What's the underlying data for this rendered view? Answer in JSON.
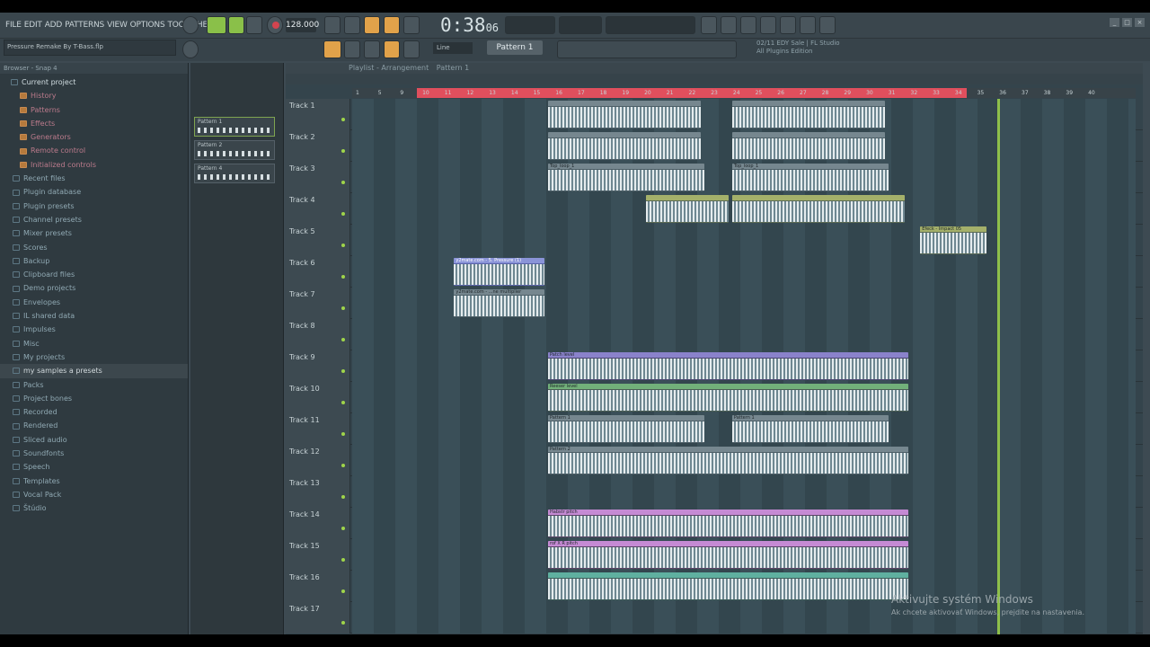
{
  "menu": [
    "FILE",
    "EDIT",
    "ADD",
    "PATTERNS",
    "VIEW",
    "OPTIONS",
    "TOOLS",
    "HELP"
  ],
  "transport": {
    "tempo": "128.000",
    "time": "0:38",
    "time_sub": "06"
  },
  "song": {
    "title": "Pressure Remake By T-Bass.flp"
  },
  "snap": {
    "value": "Line"
  },
  "pattern_selector": "Pattern 1",
  "news": {
    "line1": "02/11 EDY Sale | FL Studio",
    "line2": "All Plugins Edition"
  },
  "browser": {
    "title": "Browser - Snap 4",
    "items": [
      {
        "label": "Current project",
        "type": "head"
      },
      {
        "label": "History",
        "type": "sub"
      },
      {
        "label": "Patterns",
        "type": "sub"
      },
      {
        "label": "Effects",
        "type": "sub"
      },
      {
        "label": "Generators",
        "type": "sub"
      },
      {
        "label": "Remote control",
        "type": "sub"
      },
      {
        "label": "Initialized controls",
        "type": "sub"
      },
      {
        "label": "Recent files",
        "type": "folder"
      },
      {
        "label": "Plugin database",
        "type": "folder"
      },
      {
        "label": "Plugin presets",
        "type": "folder"
      },
      {
        "label": "Channel presets",
        "type": "folder"
      },
      {
        "label": "Mixer presets",
        "type": "folder"
      },
      {
        "label": "Scores",
        "type": "folder"
      },
      {
        "label": "Backup",
        "type": "folder"
      },
      {
        "label": "Clipboard files",
        "type": "folder"
      },
      {
        "label": "Demo projects",
        "type": "folder"
      },
      {
        "label": "Envelopes",
        "type": "folder"
      },
      {
        "label": "IL shared data",
        "type": "folder"
      },
      {
        "label": "Impulses",
        "type": "folder"
      },
      {
        "label": "Misc",
        "type": "folder"
      },
      {
        "label": "My projects",
        "type": "folder"
      },
      {
        "label": "my samples a presets",
        "type": "sel"
      },
      {
        "label": "Packs",
        "type": "folder"
      },
      {
        "label": "Project bones",
        "type": "folder"
      },
      {
        "label": "Recorded",
        "type": "folder"
      },
      {
        "label": "Rendered",
        "type": "folder"
      },
      {
        "label": "Sliced audio",
        "type": "folder"
      },
      {
        "label": "Soundfonts",
        "type": "folder"
      },
      {
        "label": "Speech",
        "type": "folder"
      },
      {
        "label": "Templates",
        "type": "folder"
      },
      {
        "label": "Vocal Pack",
        "type": "folder"
      },
      {
        "label": "Štúdio",
        "type": "folder"
      }
    ]
  },
  "picker": [
    {
      "label": "Pattern 1"
    },
    {
      "label": "Pattern 2"
    },
    {
      "label": "Pattern 4"
    }
  ],
  "playlist": {
    "title": "Playlist - Arrangement",
    "pattern": "Pattern 1",
    "ruler_numbers": [
      "1",
      "5",
      "9",
      "10",
      "11",
      "12",
      "13",
      "14",
      "15",
      "16",
      "17",
      "18",
      "19",
      "20",
      "21",
      "22",
      "23",
      "24",
      "25",
      "26",
      "27",
      "28",
      "29",
      "30",
      "31",
      "32",
      "33",
      "34",
      "35",
      "36",
      "37",
      "38",
      "39",
      "40"
    ],
    "tracks": [
      {
        "name": "Track 1",
        "clips": [
          {
            "start": 25.0,
            "len": 19.5,
            "color": "c-gray",
            "label": ""
          },
          {
            "start": 48.5,
            "len": 19.5,
            "color": "c-gray",
            "label": ""
          }
        ]
      },
      {
        "name": "Track 2",
        "clips": [
          {
            "start": 25.0,
            "len": 19.5,
            "color": "c-gray",
            "label": ""
          },
          {
            "start": 48.5,
            "len": 19.5,
            "color": "c-gray",
            "label": ""
          }
        ]
      },
      {
        "name": "Track 3",
        "clips": [
          {
            "start": 25.0,
            "len": 20,
            "color": "c-gray",
            "label": "Top_loop_1"
          },
          {
            "start": 48.5,
            "len": 20,
            "color": "c-gray",
            "label": "Top_loop_1"
          }
        ]
      },
      {
        "name": "Track 4",
        "clips": [
          {
            "start": 37.5,
            "len": 10.5,
            "color": "c-imp",
            "label": ""
          },
          {
            "start": 48.5,
            "len": 22,
            "color": "c-imp",
            "label": ""
          }
        ]
      },
      {
        "name": "Track 5",
        "clips": [
          {
            "start": 72.5,
            "len": 8.5,
            "color": "c-imp",
            "label": "Efeck - Impact 05"
          }
        ]
      },
      {
        "name": "Track 6",
        "clips": [
          {
            "start": 13.0,
            "len": 11.5,
            "color": "c-blue",
            "label": "y2mate.com - 5. Pressure (1)"
          }
        ]
      },
      {
        "name": "Track 7",
        "clips": [
          {
            "start": 13.0,
            "len": 11.5,
            "color": "c-gray",
            "label": "y2mate.com - ...ne multiplier"
          }
        ]
      },
      {
        "name": "Track 8",
        "clips": []
      },
      {
        "name": "Track 9",
        "clips": [
          {
            "start": 25.0,
            "len": 46,
            "color": "c-purp",
            "label": "Patch level"
          }
        ]
      },
      {
        "name": "Track 10",
        "clips": [
          {
            "start": 25.0,
            "len": 46,
            "color": "c-green",
            "label": "Reeser level"
          }
        ]
      },
      {
        "name": "Track 11",
        "clips": [
          {
            "start": 25.0,
            "len": 20,
            "color": "c-gray",
            "label": "Pattern 1"
          },
          {
            "start": 48.5,
            "len": 20,
            "color": "c-gray",
            "label": "Pattern 1"
          }
        ]
      },
      {
        "name": "Track 12",
        "clips": [
          {
            "start": 25.0,
            "len": 46,
            "color": "c-gray",
            "label": "Pattern 2"
          }
        ]
      },
      {
        "name": "Track 13",
        "clips": []
      },
      {
        "name": "Track 14",
        "clips": [
          {
            "start": 25.0,
            "len": 46,
            "color": "c-pink",
            "label": "Habstr pitch"
          }
        ]
      },
      {
        "name": "Track 15",
        "clips": [
          {
            "start": 25.0,
            "len": 46,
            "color": "c-pink",
            "label": "rof X R pitch"
          }
        ]
      },
      {
        "name": "Track 16",
        "clips": [
          {
            "start": 25.0,
            "len": 46,
            "color": "c-teal",
            "label": ""
          }
        ]
      },
      {
        "name": "Track 17",
        "clips": []
      }
    ]
  },
  "watermark": {
    "line1": "Aktivujte systém Windows",
    "line2": "Ak chcete aktivovať Windows, prejdite na nastavenia."
  }
}
